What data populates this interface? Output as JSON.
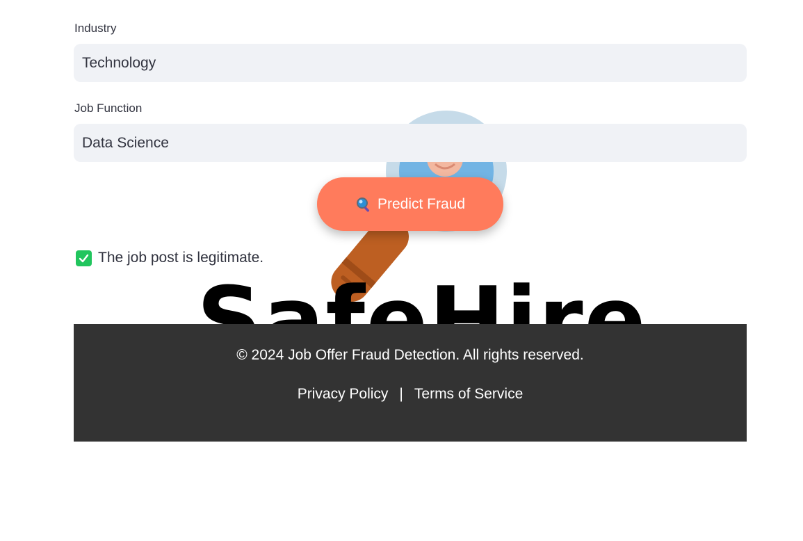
{
  "form": {
    "industry": {
      "label": "Industry",
      "value": "Technology"
    },
    "job_function": {
      "label": "Job Function",
      "value": "Data Science"
    }
  },
  "predict_button": {
    "icon": "magnifier-icon",
    "label": "Predict Fraud",
    "color": "#ff7b5c"
  },
  "result": {
    "icon": "check-icon",
    "text": "The job post is legitimate.",
    "color": "#21c55d"
  },
  "background_logo": {
    "text": "SafeHire"
  },
  "footer": {
    "copyright": "© 2024 Job Offer Fraud Detection. All rights reserved.",
    "links": [
      {
        "label": "Privacy Policy"
      },
      {
        "label": "Terms of Service"
      }
    ],
    "separator": "|",
    "background": "#333333"
  }
}
